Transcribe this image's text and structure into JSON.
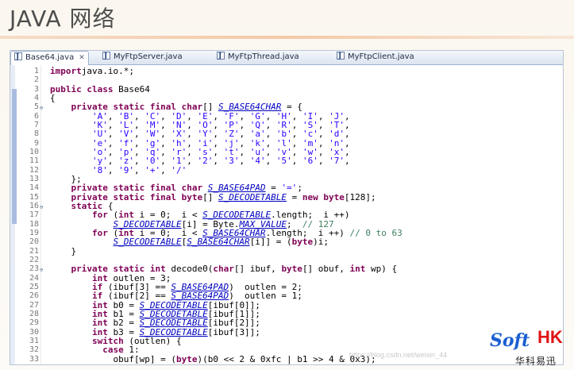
{
  "title": "JAVA 网络",
  "tabs": [
    {
      "label": "Base64.java",
      "active": true
    },
    {
      "label": "MyFtpServer.java",
      "active": false
    },
    {
      "label": "MyFtpThread.java",
      "active": false
    },
    {
      "label": "MyFtpClient.java",
      "active": false
    }
  ],
  "lines": [
    {
      "n": "1",
      "fold": false,
      "t": [
        [
          "kw",
          "import"
        ],
        [
          "",
          "java.io.*;"
        ]
      ]
    },
    {
      "n": "2",
      "fold": false,
      "t": []
    },
    {
      "n": "3",
      "fold": false,
      "t": [
        [
          "kw",
          "public class"
        ],
        [
          "",
          " Base64"
        ]
      ]
    },
    {
      "n": "4",
      "fold": false,
      "t": [
        [
          "",
          "{"
        ]
      ]
    },
    {
      "n": "5",
      "fold": true,
      "t": [
        [
          "",
          "    "
        ],
        [
          "kw",
          "private static final char"
        ],
        [
          "",
          "[] "
        ],
        [
          "sf",
          "S_BASE64CHAR"
        ],
        [
          "",
          " = {"
        ]
      ]
    },
    {
      "n": "6",
      "fold": false,
      "t": [
        [
          "",
          "        "
        ],
        [
          "st",
          "'A'"
        ],
        [
          ",",
          ", "
        ],
        [
          "st",
          "'B'"
        ],
        [
          ",",
          ", "
        ],
        [
          "st",
          "'C'"
        ],
        [
          ",",
          ", "
        ],
        [
          "st",
          "'D'"
        ],
        [
          ",",
          ", "
        ],
        [
          "st",
          "'E'"
        ],
        [
          ",",
          ", "
        ],
        [
          "st",
          "'F'"
        ],
        [
          ",",
          ", "
        ],
        [
          "st",
          "'G'"
        ],
        [
          ",",
          ", "
        ],
        [
          "st",
          "'H'"
        ],
        [
          ",",
          ", "
        ],
        [
          "st",
          "'I'"
        ],
        [
          ",",
          ", "
        ],
        [
          "st",
          "'J'"
        ],
        [
          "",
          ","
        ]
      ]
    },
    {
      "n": "7",
      "fold": false,
      "t": [
        [
          "",
          "        "
        ],
        [
          "st",
          "'K'"
        ],
        [
          ",",
          ", "
        ],
        [
          "st",
          "'L'"
        ],
        [
          ",",
          ", "
        ],
        [
          "st",
          "'M'"
        ],
        [
          ",",
          ", "
        ],
        [
          "st",
          "'N'"
        ],
        [
          ",",
          ", "
        ],
        [
          "st",
          "'O'"
        ],
        [
          ",",
          ", "
        ],
        [
          "st",
          "'P'"
        ],
        [
          ",",
          ", "
        ],
        [
          "st",
          "'Q'"
        ],
        [
          ",",
          ", "
        ],
        [
          "st",
          "'R'"
        ],
        [
          ",",
          ", "
        ],
        [
          "st",
          "'S'"
        ],
        [
          ",",
          ", "
        ],
        [
          "st",
          "'T'"
        ],
        [
          "",
          ","
        ]
      ]
    },
    {
      "n": "8",
      "fold": false,
      "t": [
        [
          "",
          "        "
        ],
        [
          "st",
          "'U'"
        ],
        [
          ",",
          ", "
        ],
        [
          "st",
          "'V'"
        ],
        [
          ",",
          ", "
        ],
        [
          "st",
          "'W'"
        ],
        [
          ",",
          ", "
        ],
        [
          "st",
          "'X'"
        ],
        [
          ",",
          ", "
        ],
        [
          "st",
          "'Y'"
        ],
        [
          ",",
          ", "
        ],
        [
          "st",
          "'Z'"
        ],
        [
          ",",
          ", "
        ],
        [
          "st",
          "'a'"
        ],
        [
          ",",
          ", "
        ],
        [
          "st",
          "'b'"
        ],
        [
          ",",
          ", "
        ],
        [
          "st",
          "'c'"
        ],
        [
          ",",
          ", "
        ],
        [
          "st",
          "'d'"
        ],
        [
          "",
          ","
        ]
      ]
    },
    {
      "n": "9",
      "fold": false,
      "t": [
        [
          "",
          "        "
        ],
        [
          "st",
          "'e'"
        ],
        [
          ",",
          ", "
        ],
        [
          "st",
          "'f'"
        ],
        [
          ",",
          ", "
        ],
        [
          "st",
          "'g'"
        ],
        [
          ",",
          ", "
        ],
        [
          "st",
          "'h'"
        ],
        [
          ",",
          ", "
        ],
        [
          "st",
          "'i'"
        ],
        [
          ",",
          ", "
        ],
        [
          "st",
          "'j'"
        ],
        [
          ",",
          ", "
        ],
        [
          "st",
          "'k'"
        ],
        [
          ",",
          ", "
        ],
        [
          "st",
          "'l'"
        ],
        [
          ",",
          ", "
        ],
        [
          "st",
          "'m'"
        ],
        [
          ",",
          ", "
        ],
        [
          "st",
          "'n'"
        ],
        [
          "",
          ","
        ]
      ]
    },
    {
      "n": "10",
      "fold": false,
      "t": [
        [
          "",
          "        "
        ],
        [
          "st",
          "'o'"
        ],
        [
          ",",
          ", "
        ],
        [
          "st",
          "'p'"
        ],
        [
          ",",
          ", "
        ],
        [
          "st",
          "'q'"
        ],
        [
          ",",
          ", "
        ],
        [
          "st",
          "'r'"
        ],
        [
          ",",
          ", "
        ],
        [
          "st",
          "'s'"
        ],
        [
          ",",
          ", "
        ],
        [
          "st",
          "'t'"
        ],
        [
          ",",
          ", "
        ],
        [
          "st",
          "'u'"
        ],
        [
          ",",
          ", "
        ],
        [
          "st",
          "'v'"
        ],
        [
          ",",
          ", "
        ],
        [
          "st",
          "'w'"
        ],
        [
          ",",
          ", "
        ],
        [
          "st",
          "'x'"
        ],
        [
          "",
          ","
        ]
      ]
    },
    {
      "n": "11",
      "fold": false,
      "t": [
        [
          "",
          "        "
        ],
        [
          "st",
          "'y'"
        ],
        [
          ",",
          ", "
        ],
        [
          "st",
          "'z'"
        ],
        [
          ",",
          ", "
        ],
        [
          "st",
          "'0'"
        ],
        [
          ",",
          ", "
        ],
        [
          "st",
          "'1'"
        ],
        [
          ",",
          ", "
        ],
        [
          "st",
          "'2'"
        ],
        [
          ",",
          ", "
        ],
        [
          "st",
          "'3'"
        ],
        [
          ",",
          ", "
        ],
        [
          "st",
          "'4'"
        ],
        [
          ",",
          ", "
        ],
        [
          "st",
          "'5'"
        ],
        [
          ",",
          ", "
        ],
        [
          "st",
          "'6'"
        ],
        [
          ",",
          ", "
        ],
        [
          "st",
          "'7'"
        ],
        [
          "",
          ","
        ]
      ]
    },
    {
      "n": "12",
      "fold": false,
      "t": [
        [
          "",
          "        "
        ],
        [
          "st",
          "'8'"
        ],
        [
          ",",
          ", "
        ],
        [
          "st",
          "'9'"
        ],
        [
          ",",
          ", "
        ],
        [
          "st",
          "'+'"
        ],
        [
          ",",
          ", "
        ],
        [
          "st",
          "'/'"
        ]
      ]
    },
    {
      "n": "13",
      "fold": false,
      "t": [
        [
          "",
          "    };"
        ]
      ]
    },
    {
      "n": "14",
      "fold": false,
      "t": [
        [
          "",
          "    "
        ],
        [
          "kw",
          "private static final char"
        ],
        [
          "",
          " "
        ],
        [
          "sf",
          "S_BASE64PAD"
        ],
        [
          "",
          " = "
        ],
        [
          "st",
          "'='"
        ],
        [
          "",
          ";"
        ]
      ]
    },
    {
      "n": "15",
      "fold": false,
      "t": [
        [
          "",
          "    "
        ],
        [
          "kw",
          "private static final byte"
        ],
        [
          "",
          "[] "
        ],
        [
          "sf",
          "S_DECODETABLE"
        ],
        [
          "",
          " = "
        ],
        [
          "kw",
          "new byte"
        ],
        [
          "",
          "[128];"
        ]
      ]
    },
    {
      "n": "16",
      "fold": true,
      "t": [
        [
          "",
          "    "
        ],
        [
          "kw",
          "static"
        ],
        [
          "",
          " {"
        ]
      ]
    },
    {
      "n": "17",
      "fold": false,
      "t": [
        [
          "",
          "        "
        ],
        [
          "kw",
          "for"
        ],
        [
          "",
          " ("
        ],
        [
          "kw",
          "int"
        ],
        [
          "",
          " i = 0;  i < "
        ],
        [
          "sf",
          "S_DECODETABLE"
        ],
        [
          "",
          ".length;  i ++)"
        ]
      ]
    },
    {
      "n": "18",
      "fold": false,
      "t": [
        [
          "",
          "            "
        ],
        [
          "sf",
          "S_DECODETABLE"
        ],
        [
          "",
          "[i] = Byte."
        ],
        [
          "sf",
          "MAX_VALUE"
        ],
        [
          "",
          ";  "
        ],
        [
          "cm",
          "// 127"
        ]
      ]
    },
    {
      "n": "19",
      "fold": false,
      "t": [
        [
          "",
          "        "
        ],
        [
          "kw",
          "for"
        ],
        [
          "",
          " ("
        ],
        [
          "kw",
          "int"
        ],
        [
          "",
          " i = 0;  i < "
        ],
        [
          "sf",
          "S_BASE64CHAR"
        ],
        [
          "",
          ".length;  i ++) "
        ],
        [
          "cm",
          "// 0 to 63"
        ]
      ]
    },
    {
      "n": "20",
      "fold": false,
      "t": [
        [
          "",
          "            "
        ],
        [
          "sf",
          "S_DECODETABLE"
        ],
        [
          "",
          "["
        ],
        [
          "sf",
          "S_BASE64CHAR"
        ],
        [
          "",
          "[i]] = ("
        ],
        [
          "kw",
          "byte"
        ],
        [
          "",
          ")i;"
        ]
      ]
    },
    {
      "n": "21",
      "fold": false,
      "t": [
        [
          "",
          "    }"
        ]
      ]
    },
    {
      "n": "22",
      "fold": false,
      "t": []
    },
    {
      "n": "23",
      "fold": true,
      "t": [
        [
          "",
          "    "
        ],
        [
          "kw",
          "private static int"
        ],
        [
          "",
          " decode0("
        ],
        [
          "kw",
          "char"
        ],
        [
          "",
          "[] ibuf, "
        ],
        [
          "kw",
          "byte"
        ],
        [
          "",
          "[] obuf, "
        ],
        [
          "kw",
          "int"
        ],
        [
          "",
          " wp) {"
        ]
      ]
    },
    {
      "n": "24",
      "fold": false,
      "t": [
        [
          "",
          "        "
        ],
        [
          "kw",
          "int"
        ],
        [
          "",
          " outlen = 3;"
        ]
      ]
    },
    {
      "n": "25",
      "fold": false,
      "t": [
        [
          "",
          "        "
        ],
        [
          "kw",
          "if"
        ],
        [
          "",
          " (ibuf[3] == "
        ],
        [
          "sf",
          "S_BASE64PAD"
        ],
        [
          "",
          ")  outlen = 2;"
        ]
      ]
    },
    {
      "n": "26",
      "fold": false,
      "t": [
        [
          "",
          "        "
        ],
        [
          "kw",
          "if"
        ],
        [
          "",
          " (ibuf[2] == "
        ],
        [
          "sf",
          "S_BASE64PAD"
        ],
        [
          "",
          ")  outlen = 1;"
        ]
      ]
    },
    {
      "n": "27",
      "fold": false,
      "t": [
        [
          "",
          "        "
        ],
        [
          "kw",
          "int"
        ],
        [
          "",
          " b0 = "
        ],
        [
          "sf",
          "S_DECODETABLE"
        ],
        [
          "",
          "[ibuf[0]];"
        ]
      ]
    },
    {
      "n": "28",
      "fold": false,
      "t": [
        [
          "",
          "        "
        ],
        [
          "kw",
          "int"
        ],
        [
          "",
          " b1 = "
        ],
        [
          "sf",
          "S_DECODETABLE"
        ],
        [
          "",
          "[ibuf[1]];"
        ]
      ]
    },
    {
      "n": "29",
      "fold": false,
      "t": [
        [
          "",
          "        "
        ],
        [
          "kw",
          "int"
        ],
        [
          "",
          " b2 = "
        ],
        [
          "sf",
          "S_DECODETABLE"
        ],
        [
          "",
          "[ibuf[2]];"
        ]
      ]
    },
    {
      "n": "30",
      "fold": false,
      "t": [
        [
          "",
          "        "
        ],
        [
          "kw",
          "int"
        ],
        [
          "",
          " b3 = "
        ],
        [
          "sf",
          "S_DECODETABLE"
        ],
        [
          "",
          "[ibuf[3]];"
        ]
      ]
    },
    {
      "n": "31",
      "fold": false,
      "t": [
        [
          "",
          "        "
        ],
        [
          "kw",
          "switch"
        ],
        [
          "",
          " (outlen) {"
        ]
      ]
    },
    {
      "n": "32",
      "fold": false,
      "t": [
        [
          "",
          "          "
        ],
        [
          "kw",
          "case"
        ],
        [
          "",
          " 1:"
        ]
      ]
    },
    {
      "n": "33",
      "fold": false,
      "t": [
        [
          "",
          "            obuf[wp] = ("
        ],
        [
          "kw",
          "byte"
        ],
        [
          "",
          ")(b0 << 2 & 0xfc | b1 >> 4 & 0x3);"
        ]
      ]
    }
  ],
  "logo": {
    "soft": "Soft",
    "hk": "HK",
    "cn": "华科易迅"
  },
  "watermark": "https://blog.csdn.net/weixin_44"
}
